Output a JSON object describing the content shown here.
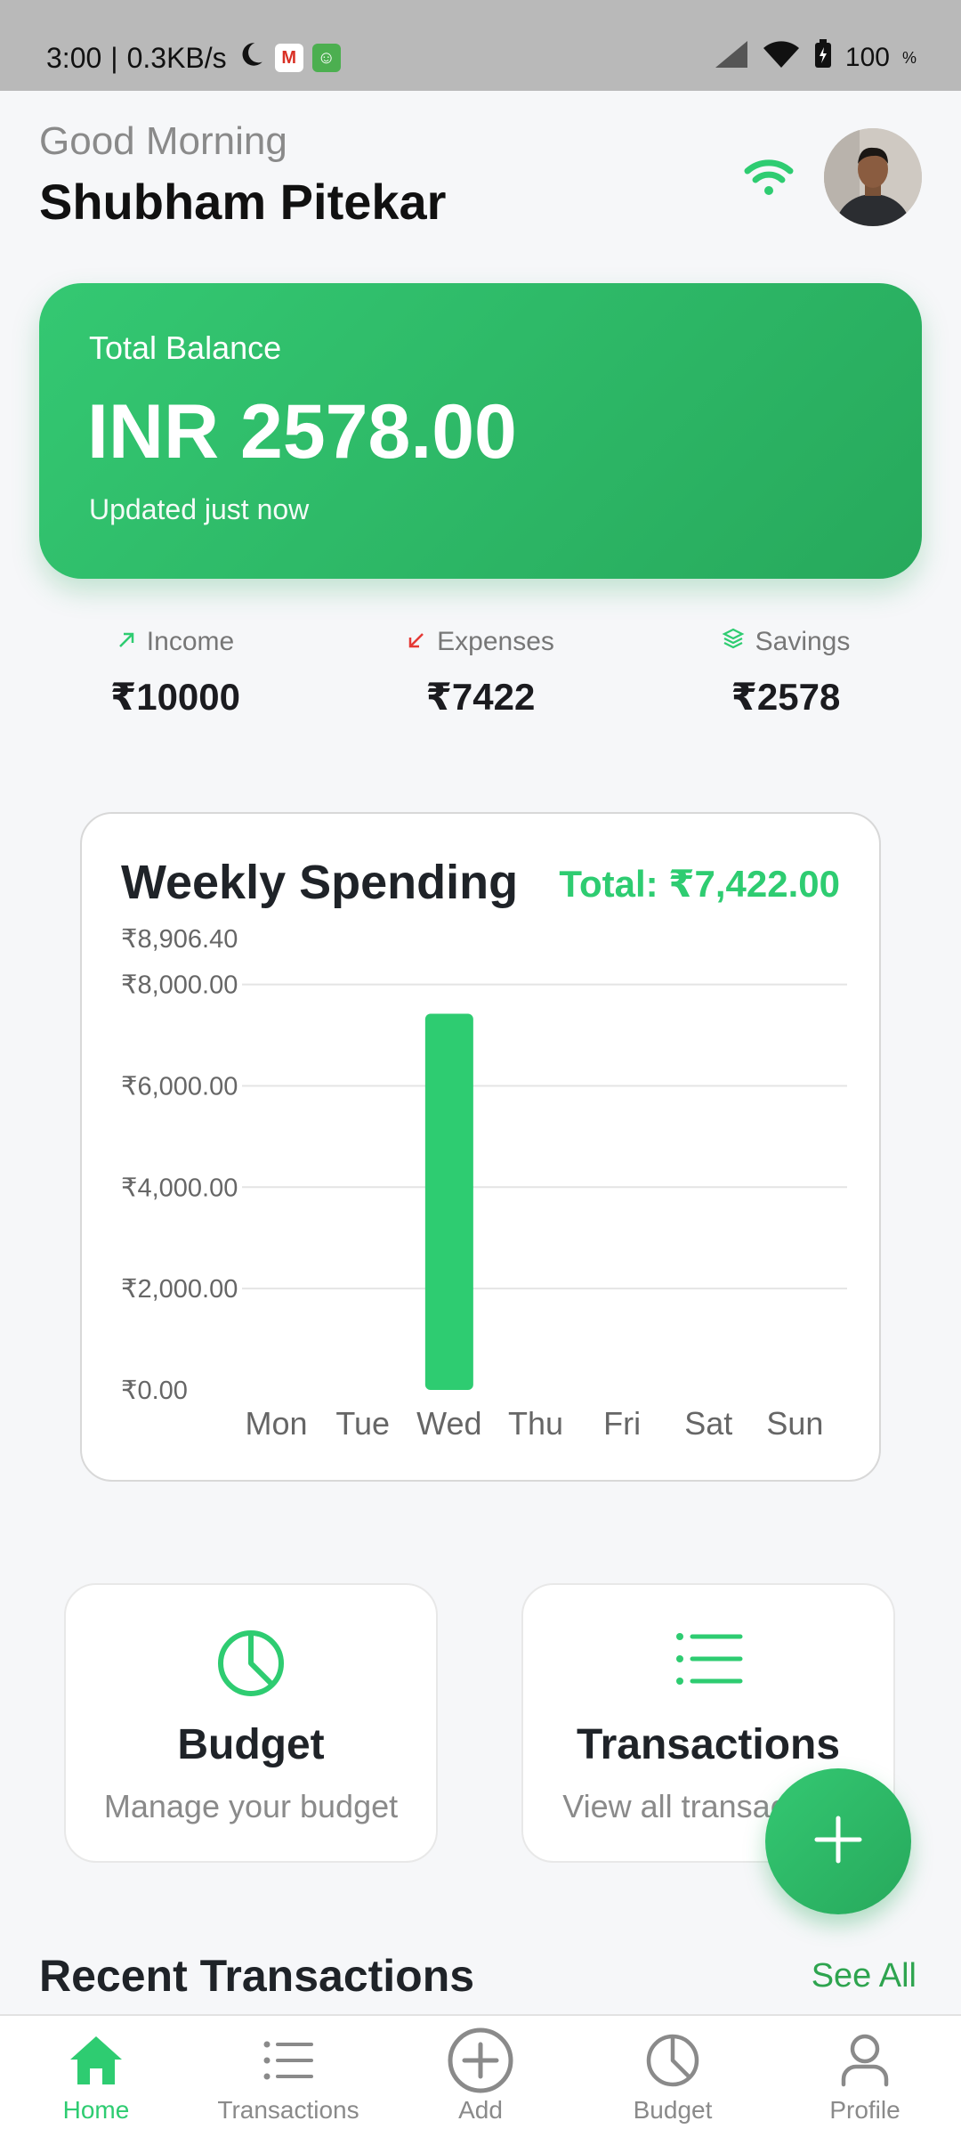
{
  "status_bar": {
    "time": "3:00",
    "speed": "0.3KB/s",
    "battery": "100"
  },
  "header": {
    "greeting": "Good Morning",
    "user_name": "Shubham Pitekar"
  },
  "balance": {
    "label": "Total Balance",
    "amount": "INR 2578.00",
    "updated": "Updated just now"
  },
  "stats": [
    {
      "label": "Income",
      "value": "₹10000",
      "icon": "arrow-up-right-icon"
    },
    {
      "label": "Expenses",
      "value": "₹7422",
      "icon": "arrow-down-left-icon"
    },
    {
      "label": "Savings",
      "value": "₹2578",
      "icon": "layers-icon"
    }
  ],
  "weekly": {
    "title": "Weekly Spending",
    "total": "Total: ₹7,422.00"
  },
  "chart_data": {
    "type": "bar",
    "categories": [
      "Mon",
      "Tue",
      "Wed",
      "Thu",
      "Fri",
      "Sat",
      "Sun"
    ],
    "values": [
      0,
      0,
      7422,
      0,
      0,
      0,
      0
    ],
    "ylim": [
      0,
      8906.4
    ],
    "yticks": [
      {
        "value": 8906.4,
        "label": "₹8,906.40"
      },
      {
        "value": 8000,
        "label": "₹8,000.00"
      },
      {
        "value": 6000,
        "label": "₹6,000.00"
      },
      {
        "value": 4000,
        "label": "₹4,000.00"
      },
      {
        "value": 2000,
        "label": "₹2,000.00"
      },
      {
        "value": 0,
        "label": "₹0.00"
      }
    ],
    "grid": true,
    "bar_color": "#2ecc71"
  },
  "cards": {
    "budget": {
      "title": "Budget",
      "subtitle": "Manage your budget"
    },
    "transactions": {
      "title": "Transactions",
      "subtitle": "View all transactions"
    }
  },
  "recent": {
    "title": "Recent Transactions",
    "see_all": "See All"
  },
  "nav": [
    {
      "label": "Home",
      "icon": "home-icon",
      "active": true
    },
    {
      "label": "Transactions",
      "icon": "list-icon",
      "active": false
    },
    {
      "label": "Add",
      "icon": "plus-circle-icon",
      "active": false
    },
    {
      "label": "Budget",
      "icon": "pie-chart-icon",
      "active": false
    },
    {
      "label": "Profile",
      "icon": "user-icon",
      "active": false
    }
  ],
  "colors": {
    "accent": "#2ecc71",
    "accent_dark": "#27a95c",
    "muted": "#8a8a8a"
  }
}
